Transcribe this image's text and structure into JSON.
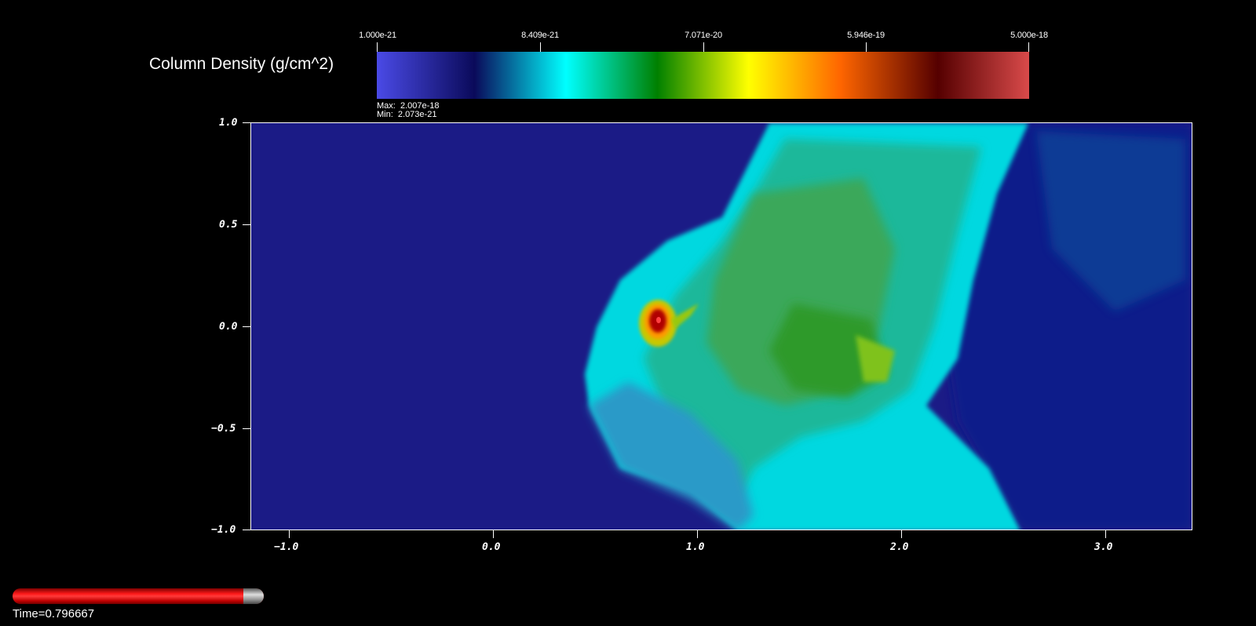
{
  "legend": {
    "title": "Column Density (g/cm^2)",
    "ticks": [
      "1.000e-21",
      "8.409e-21",
      "7.071e-20",
      "5.946e-19",
      "5.000e-18"
    ],
    "max_label": "Max:  2.007e-18",
    "min_label": "Min:  2.073e-21"
  },
  "axes": {
    "y_ticks": [
      "1.0",
      "0.5",
      "0.0",
      "−0.5",
      "−1.0"
    ],
    "x_ticks": [
      "−1.0",
      "0.0",
      "1.0",
      "2.0",
      "3.0"
    ]
  },
  "time": {
    "label": "Time=0.796667",
    "progress": 0.796667
  },
  "colors": {
    "background": "#1b1b86",
    "colormap": [
      "#4a4ae6",
      "#0a0a5a",
      "#00ffff",
      "#008000",
      "#ffff00",
      "#ff6600",
      "#550000",
      "#d94a4a"
    ]
  }
}
